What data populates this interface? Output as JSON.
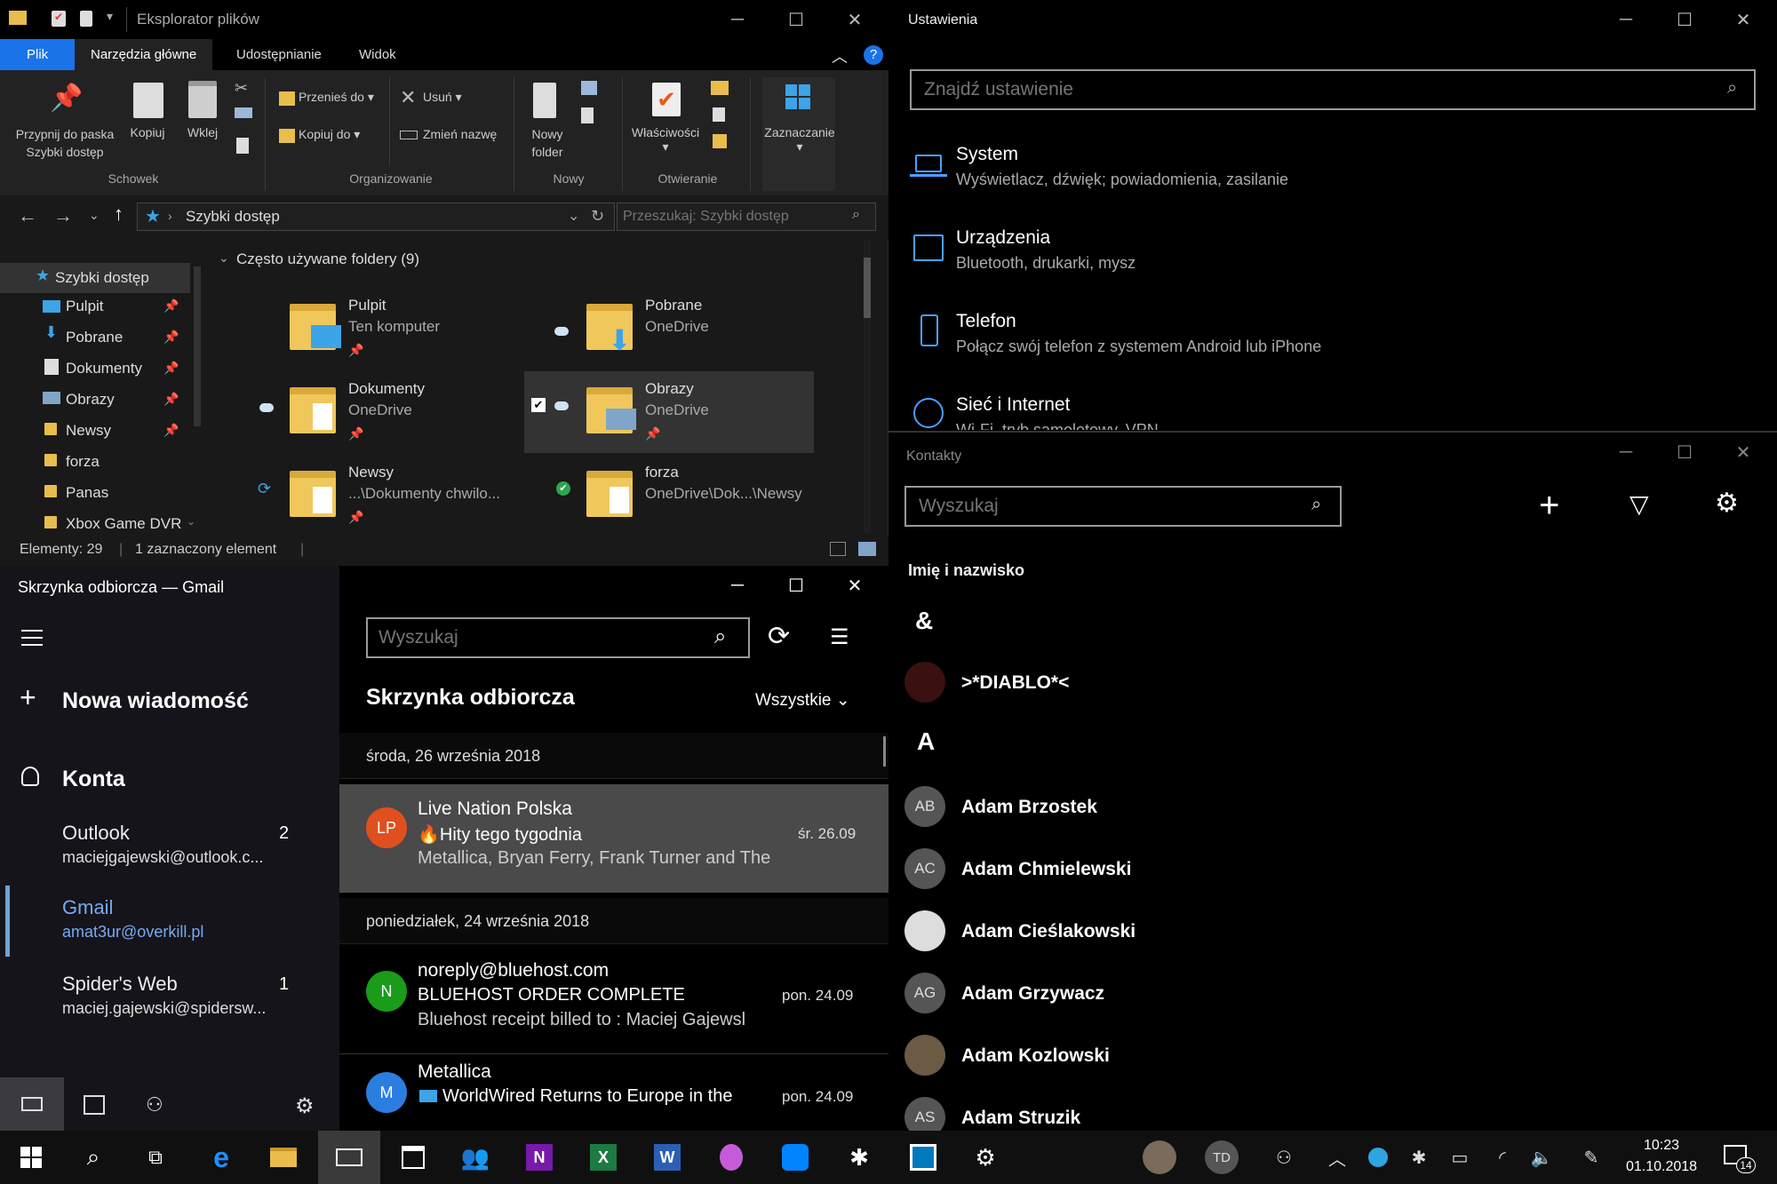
{
  "explorer": {
    "title": "Eksplorator plików",
    "tabs": [
      "Plik",
      "Narzędzia główne",
      "Udostępnianie",
      "Widok"
    ],
    "ribbon": {
      "pin_label": "Przypnij do paska Szybki dostęp",
      "copy": "Kopiuj",
      "paste": "Wklej",
      "group_clipboard": "Schowek",
      "move_to": "Przenieś do",
      "copy_to": "Kopiuj do",
      "delete": "Usuń",
      "rename": "Zmień nazwę",
      "group_organize": "Organizowanie",
      "new_folder": "Nowy folder",
      "group_new": "Nowy",
      "properties": "Właściwości",
      "group_open": "Otwieranie",
      "select": "Zaznaczanie"
    },
    "address": "Szybki dostęp",
    "search_placeholder": "Przeszukaj: Szybki dostęp",
    "nav": [
      {
        "label": "Szybki dostęp",
        "icon": "star-icon"
      },
      {
        "label": "Pulpit",
        "icon": "desktop-icon"
      },
      {
        "label": "Pobrane",
        "icon": "download-icon"
      },
      {
        "label": "Dokumenty",
        "icon": "document-icon"
      },
      {
        "label": "Obrazy",
        "icon": "image-icon"
      },
      {
        "label": "Newsy",
        "icon": "folder-icon"
      },
      {
        "label": "forza",
        "icon": "folder-icon"
      },
      {
        "label": "Panas",
        "icon": "folder-icon"
      },
      {
        "label": "Xbox Game DVR",
        "icon": "folder-icon"
      }
    ],
    "section_header": "Często używane foldery (9)",
    "folders": [
      {
        "name": "Pulpit",
        "sub": "Ten komputer"
      },
      {
        "name": "Pobrane",
        "sub": "OneDrive"
      },
      {
        "name": "Dokumenty",
        "sub": "OneDrive"
      },
      {
        "name": "Obrazy",
        "sub": "OneDrive"
      },
      {
        "name": "Newsy",
        "sub": "...\\Dokumenty chwilo..."
      },
      {
        "name": "forza",
        "sub": "OneDrive\\Dok...\\Newsy"
      }
    ],
    "status": {
      "items": "Elementy: 29",
      "selected": "1 zaznaczony element"
    }
  },
  "settings": {
    "title": "Ustawienia",
    "search_placeholder": "Znajdź ustawienie",
    "items": [
      {
        "title": "System",
        "sub": "Wyświetlacz, dźwięk; powiadomienia, zasilanie",
        "icon": "laptop-icon"
      },
      {
        "title": "Urządzenia",
        "sub": "Bluetooth, drukarki, mysz",
        "icon": "devices-icon"
      },
      {
        "title": "Telefon",
        "sub": "Połącz swój telefon z systemem Android lub iPhone",
        "icon": "phone-icon"
      },
      {
        "title": "Sieć i Internet",
        "sub": "Wi-Fi, tryb samolotowy, VPN",
        "icon": "globe-icon"
      }
    ]
  },
  "contacts": {
    "title": "Kontakty",
    "search_placeholder": "Wyszukaj",
    "column_header": "Imię i nazwisko",
    "groups": [
      {
        "letter": "&",
        "people": [
          {
            "name": ">*DIABLO*<",
            "initials": ""
          }
        ]
      },
      {
        "letter": "A",
        "people": [
          {
            "name": "Adam Brzostek",
            "initials": "AB"
          },
          {
            "name": "Adam Chmielewski",
            "initials": "AC"
          },
          {
            "name": "Adam Cieślakowski",
            "initials": ""
          },
          {
            "name": "Adam Grzywacz",
            "initials": "AG"
          },
          {
            "name": "Adam Kozlowski",
            "initials": ""
          },
          {
            "name": "Adam Struzik",
            "initials": "AS"
          }
        ]
      }
    ]
  },
  "mail": {
    "title": "Skrzynka odbiorcza — Gmail",
    "new_message": "Nowa wiadomość",
    "accounts_header": "Konta",
    "accounts": [
      {
        "name": "Outlook",
        "email": "maciejgajewski@outlook.c...",
        "count": "2"
      },
      {
        "name": "Gmail",
        "email": "amat3ur@overkill.pl",
        "count": ""
      },
      {
        "name": "Spider's Web",
        "email": "maciej.gajewski@spidersw...",
        "count": "1"
      }
    ],
    "search_placeholder": "Wyszukaj",
    "folder_title": "Skrzynka odbiorcza",
    "filter": "Wszystkie",
    "date_groups": [
      "środa, 26 września 2018",
      "poniedziałek, 24 września 2018"
    ],
    "messages": [
      {
        "initials": "LP",
        "color": "#e0501e",
        "sender": "Live Nation Polska",
        "subject": "🔥Hity tego tygodnia",
        "preview": "Metallica, Bryan Ferry, Frank Turner and The",
        "date": "śr. 26.09"
      },
      {
        "initials": "N",
        "color": "#1a9b1a",
        "sender": "noreply@bluehost.com",
        "subject": "BLUEHOST ORDER COMPLETE",
        "preview": "Bluehost receipt billed to : Maciej Gajewsl",
        "date": "pon. 24.09"
      },
      {
        "initials": "M",
        "color": "#2a7de1",
        "sender": "Metallica",
        "subject": "WorldWired Returns to Europe in the",
        "preview": "",
        "date": "pon. 24.09"
      }
    ]
  },
  "taskbar": {
    "user_initials": "TD",
    "time": "10:23",
    "date": "01.10.2018",
    "notifications": "14"
  }
}
